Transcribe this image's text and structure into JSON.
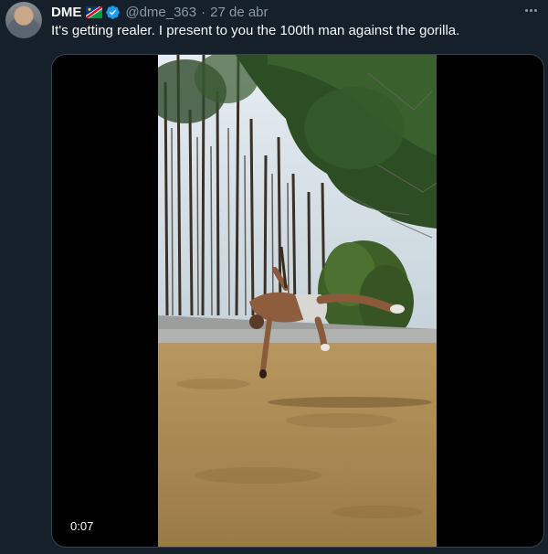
{
  "tweet": {
    "display_name": "DME",
    "flag_icon": "namibia-flag-icon",
    "verified_icon": "verified-badge-icon",
    "handle": "@dme_363",
    "separator": "·",
    "date": "27 de abr",
    "text": "It's getting realer. I present to you the 100th man against the gorilla.",
    "more_icon": "more-options-icon"
  },
  "media": {
    "type": "video",
    "duration": "0:07",
    "scene": "person doing a flip on a dry lawn with pine trees in background"
  },
  "colors": {
    "background": "#15202b",
    "text_primary": "#f7f9f9",
    "text_secondary": "#8b98a5",
    "verified": "#1d9bf0",
    "media_border": "#38444d"
  }
}
